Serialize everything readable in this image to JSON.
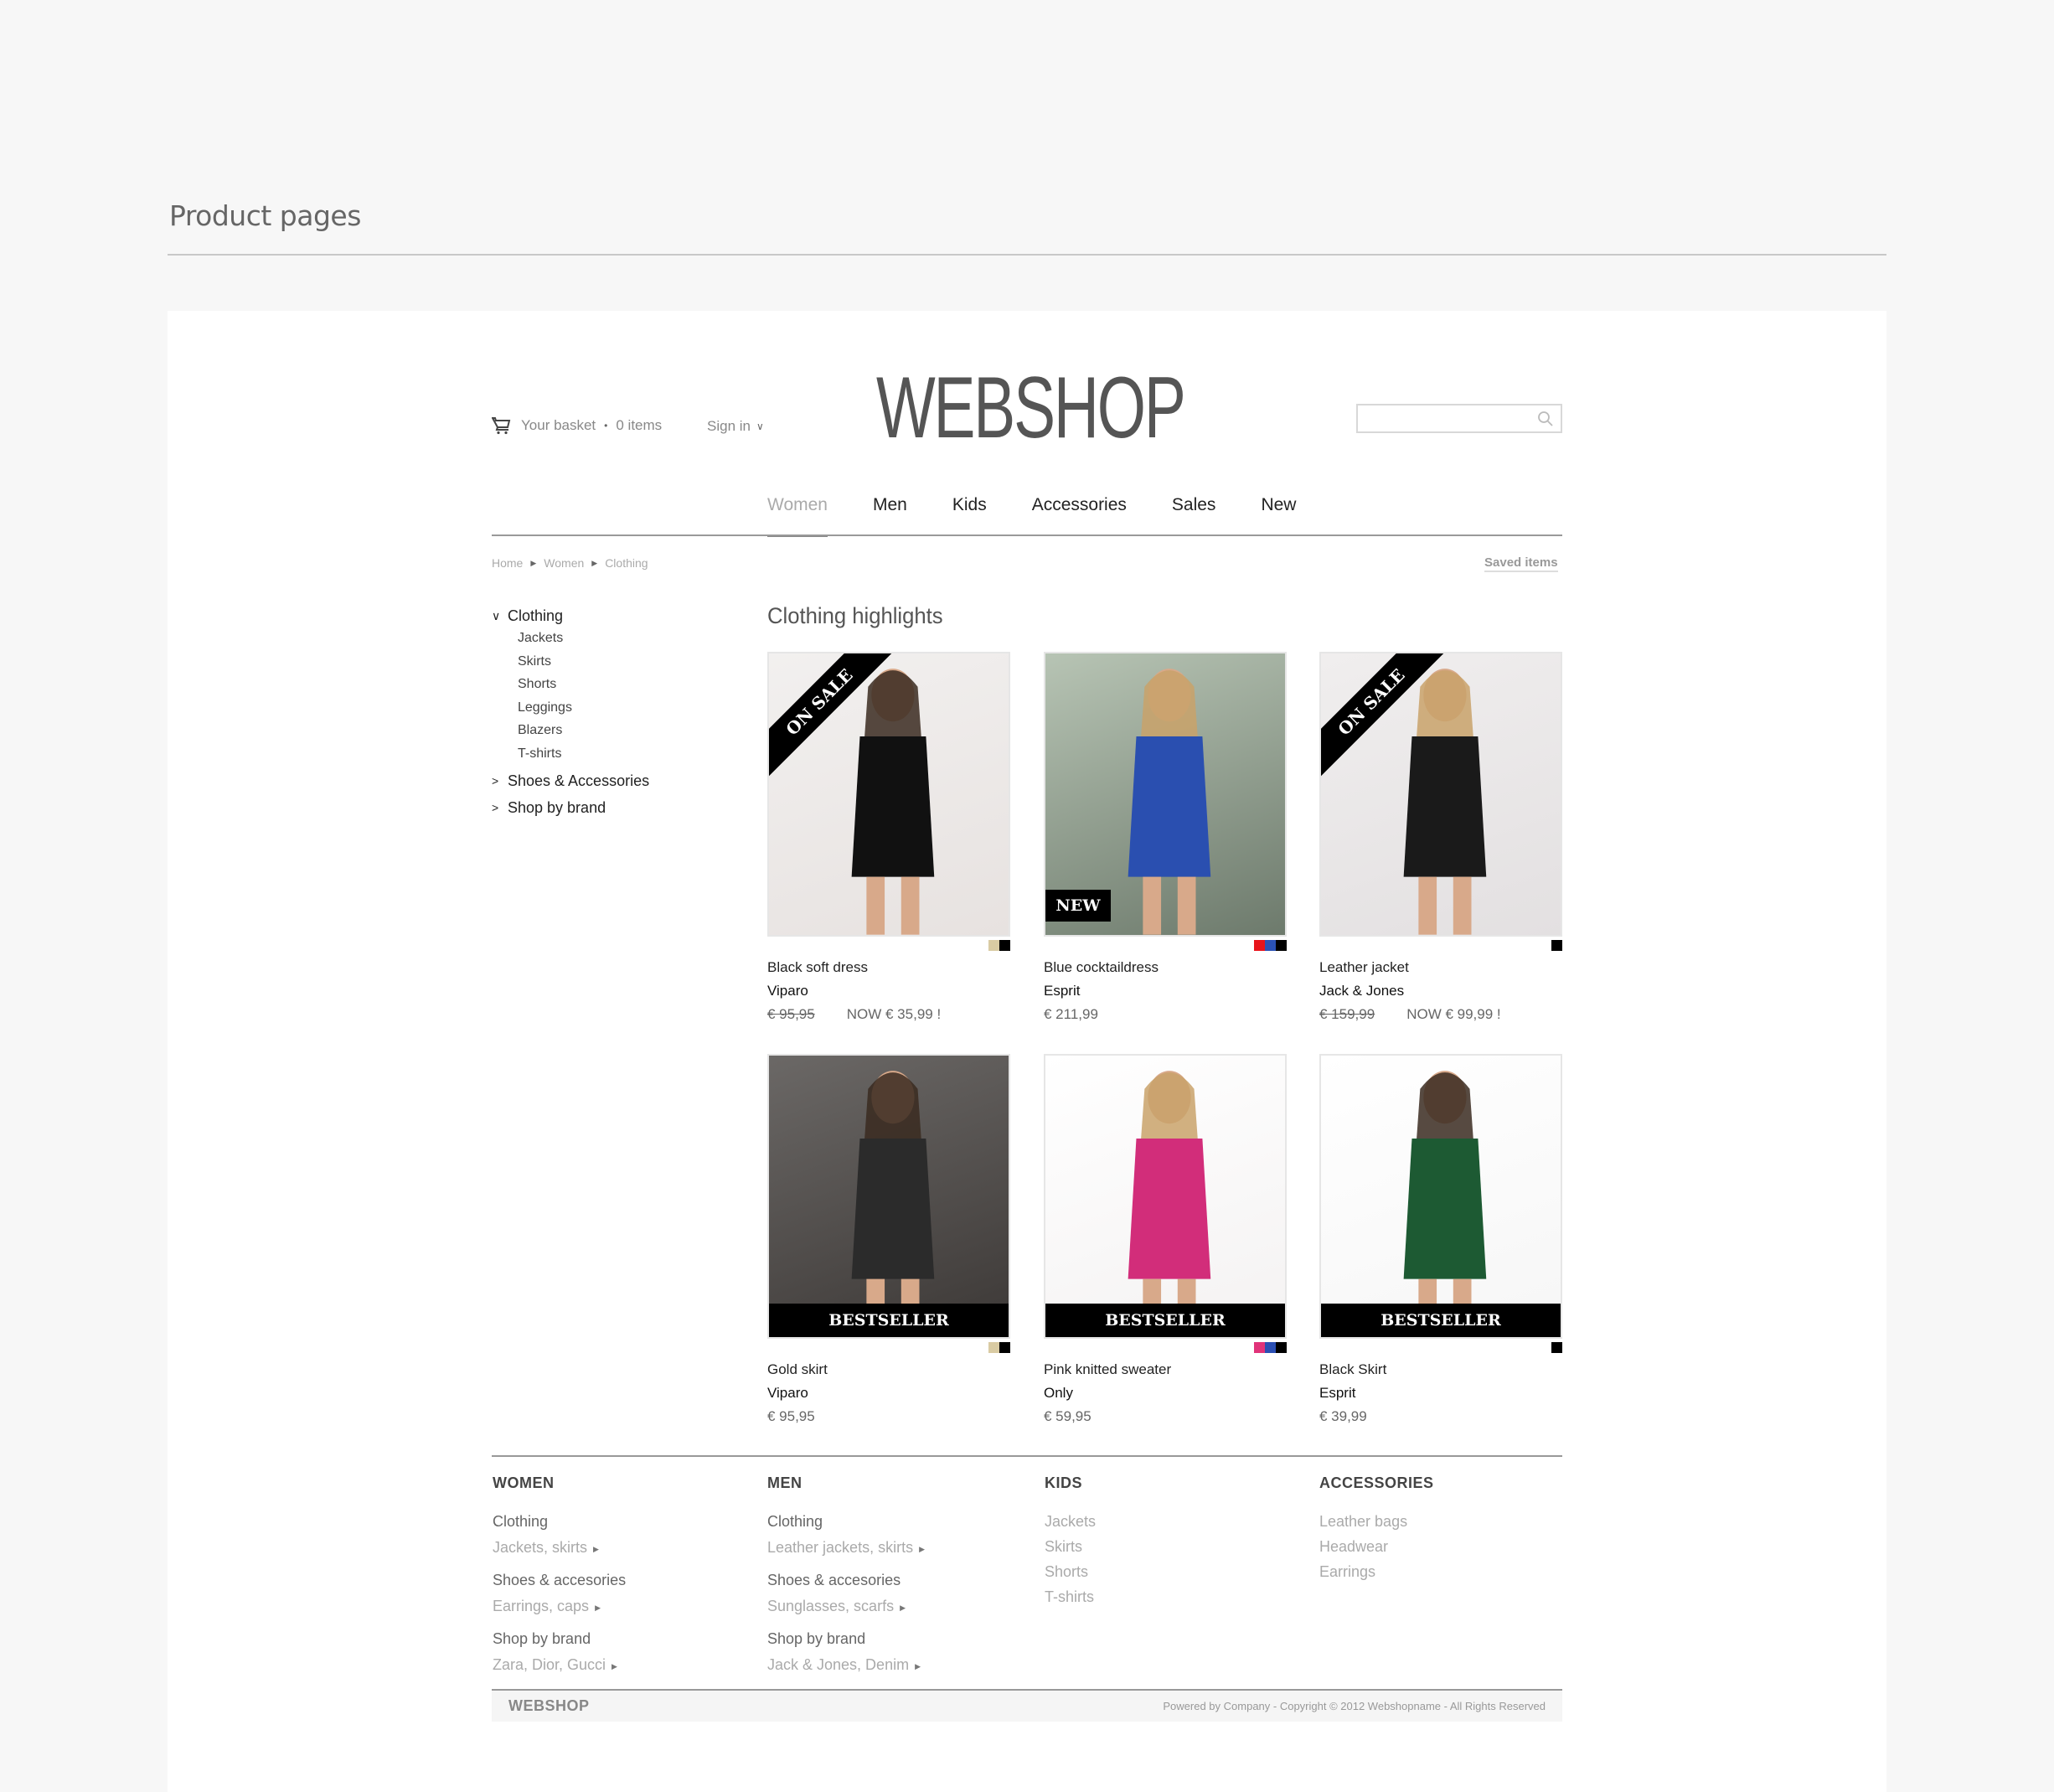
{
  "section_title": "Product pages",
  "header": {
    "basket_label": "Your basket",
    "basket_count": "0 items",
    "signin_label": "Sign in",
    "logo": "WEBSHOP",
    "search_placeholder": ""
  },
  "nav": [
    {
      "label": "Women",
      "active": true
    },
    {
      "label": "Men",
      "active": false
    },
    {
      "label": "Kids",
      "active": false
    },
    {
      "label": "Accessories",
      "active": false
    },
    {
      "label": "Sales",
      "active": false
    },
    {
      "label": "New",
      "active": false
    }
  ],
  "breadcrumb": [
    "Home",
    "Women",
    "Clothing"
  ],
  "saved_items": "Saved items",
  "sidebar": {
    "open_group": {
      "label": "Clothing",
      "items": [
        "Jackets",
        "Skirts",
        "Shorts",
        "Leggings",
        "Blazers",
        "T-shirts"
      ]
    },
    "collapsed_groups": [
      "Shoes & Accessories",
      "Shop by brand"
    ]
  },
  "grid_title": "Clothing highlights",
  "products": [
    {
      "name": "Black soft dress",
      "brand": "Viparo",
      "old_price": "€ 95,95",
      "price": "NOW € 35,99 !",
      "badge": "ON SALE",
      "swatches": [
        "#d9cba3",
        "#000000"
      ],
      "image_tone": [
        "#f2f0ef",
        "#e7e2e0"
      ]
    },
    {
      "name": "Blue cocktaildress",
      "brand": "Esprit",
      "old_price": "",
      "price": "€ 211,99",
      "badge": "NEW",
      "swatches": [
        "#e8141b",
        "#2b52b5",
        "#000000"
      ],
      "image_tone": [
        "#b7c4b4",
        "#6d7a6c"
      ]
    },
    {
      "name": "Leather jacket",
      "brand": "Jack & Jones",
      "old_price": "€ 159,99",
      "price": "NOW € 99,99 !",
      "badge": "ON SALE",
      "swatches": [
        "#000000"
      ],
      "image_tone": [
        "#f0eeee",
        "#e3e0e1"
      ]
    },
    {
      "name": "Gold skirt",
      "brand": "Viparo",
      "old_price": "",
      "price": "€ 95,95",
      "badge": "BESTSELLER",
      "swatches": [
        "#d9cba3",
        "#000000"
      ],
      "image_tone": [
        "#6b6866",
        "#3c3836"
      ]
    },
    {
      "name": "Pink knitted sweater",
      "brand": "Only",
      "old_price": "",
      "price": "€ 59,95",
      "badge": "BESTSELLER",
      "swatches": [
        "#e03379",
        "#2b4fb3",
        "#000000"
      ],
      "image_tone": [
        "#ffffff",
        "#f4f2f2"
      ]
    },
    {
      "name": "Black Skirt",
      "brand": "Esprit",
      "old_price": "",
      "price": "€ 39,99",
      "badge": "BESTSELLER",
      "swatches": [
        "#000000"
      ],
      "image_tone": [
        "#ffffff",
        "#f6f6f6"
      ]
    }
  ],
  "footer": {
    "columns": [
      {
        "head": "WOMEN",
        "groups": [
          {
            "title": "Clothing",
            "sub": "Jackets, skirts"
          },
          {
            "title": "Shoes & accesories",
            "sub": "Earrings, caps"
          },
          {
            "title": "Shop by brand",
            "sub": "Zara, Dior, Gucci"
          }
        ]
      },
      {
        "head": "MEN",
        "groups": [
          {
            "title": "Clothing",
            "sub": "Leather jackets, skirts"
          },
          {
            "title": "Shoes & accesories",
            "sub": "Sunglasses, scarfs"
          },
          {
            "title": "Shop by brand",
            "sub": "Jack & Jones, Denim"
          }
        ]
      },
      {
        "head": "KIDS",
        "links": [
          "Jackets",
          "Skirts",
          "Shorts",
          "T-shirts"
        ]
      },
      {
        "head": "ACCESSORIES",
        "links": [
          "Leather bags",
          "Headwear",
          "Earrings"
        ]
      }
    ],
    "brand": "WEBSHOP",
    "copyright": "Powered by Company - Copyright © 2012 Webshopname - All Rights Reserved"
  }
}
